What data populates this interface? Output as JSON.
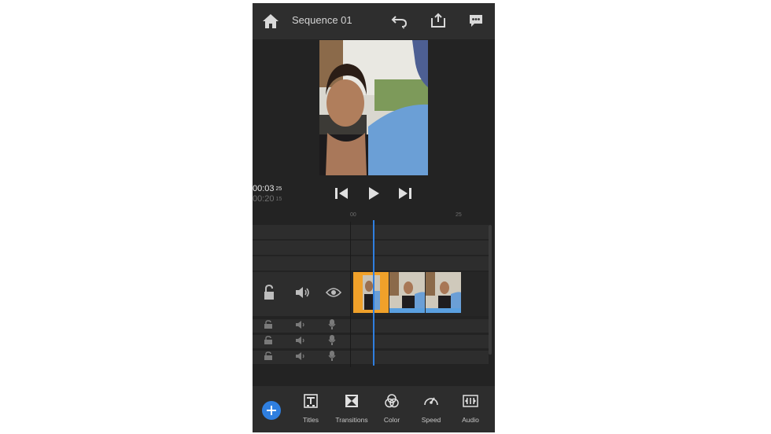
{
  "header": {
    "title": "Sequence 01",
    "home_icon": "home-icon",
    "undo_icon": "undo-icon",
    "share_icon": "share-icon",
    "feedback_icon": "feedback-icon"
  },
  "playback": {
    "current_time": "00:03",
    "current_frames": "25",
    "total_time": "00:20",
    "total_frames": "15",
    "step_back_icon": "step-back-icon",
    "play_icon": "play-icon",
    "step_forward_icon": "step-forward-icon"
  },
  "ruler": {
    "start_label": "00",
    "end_label": "25"
  },
  "tracks": {
    "video": {
      "lock_icon": "unlock-icon",
      "volume_icon": "volume-icon",
      "visibility_icon": "eye-icon"
    },
    "audio_rows": 3,
    "clips": 3
  },
  "toolbar": {
    "add_icon": "plus-icon",
    "tools": [
      {
        "label": "Titles",
        "icon": "titles-icon"
      },
      {
        "label": "Transitions",
        "icon": "transitions-icon"
      },
      {
        "label": "Color",
        "icon": "color-icon"
      },
      {
        "label": "Speed",
        "icon": "speed-icon"
      },
      {
        "label": "Audio",
        "icon": "audio-icon"
      }
    ]
  },
  "colors": {
    "accent": "#2f7fe0",
    "selected_clip": "#f0a12a",
    "background": "#232323"
  }
}
